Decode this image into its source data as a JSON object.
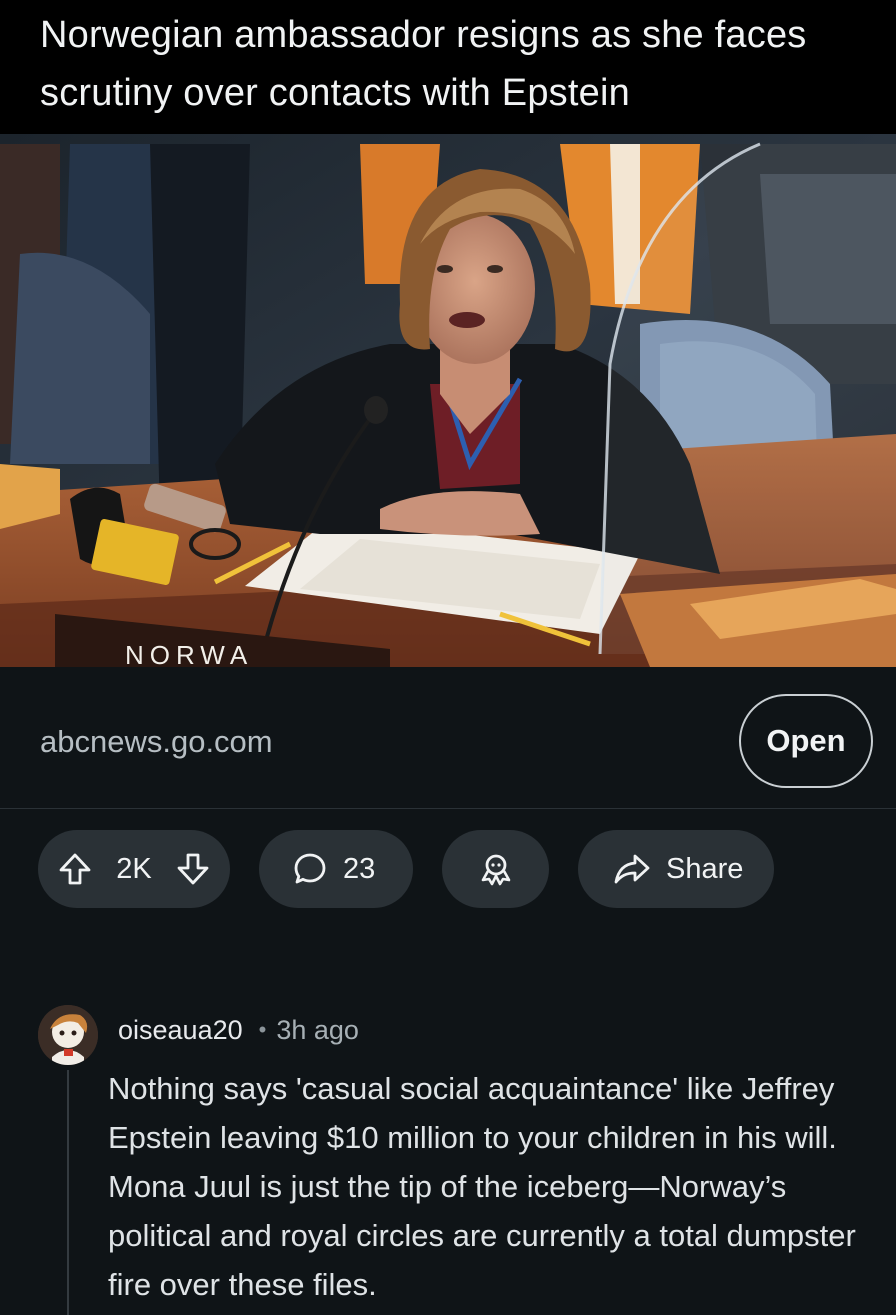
{
  "post": {
    "title": "Norwegian ambassador resigns as she faces scrutiny over contacts with Epstein",
    "image_nameplate": "NORWA"
  },
  "link": {
    "domain": "abcnews.go.com",
    "open_label": "Open"
  },
  "actions": {
    "vote_count": "2K",
    "comment_count": "23",
    "share_label": "Share",
    "icons": [
      "upvote-icon",
      "downvote-icon",
      "comment-icon",
      "award-icon",
      "share-icon"
    ]
  },
  "comment": {
    "username": "oiseaua20",
    "separator": "•",
    "time": "3h ago",
    "body": "Nothing says 'casual social acquaintance' like Jeffrey Epstein leaving $10 million to your children in his will. Mona Juul is just the tip of the iceberg—Norway’s political and royal circles are currently a total dumpster fire over these files."
  },
  "colors": {
    "background": "#000000",
    "card": "#0f1417",
    "pill": "#2a3136",
    "text": "#f1f3f4",
    "muted": "#b6bec3"
  }
}
